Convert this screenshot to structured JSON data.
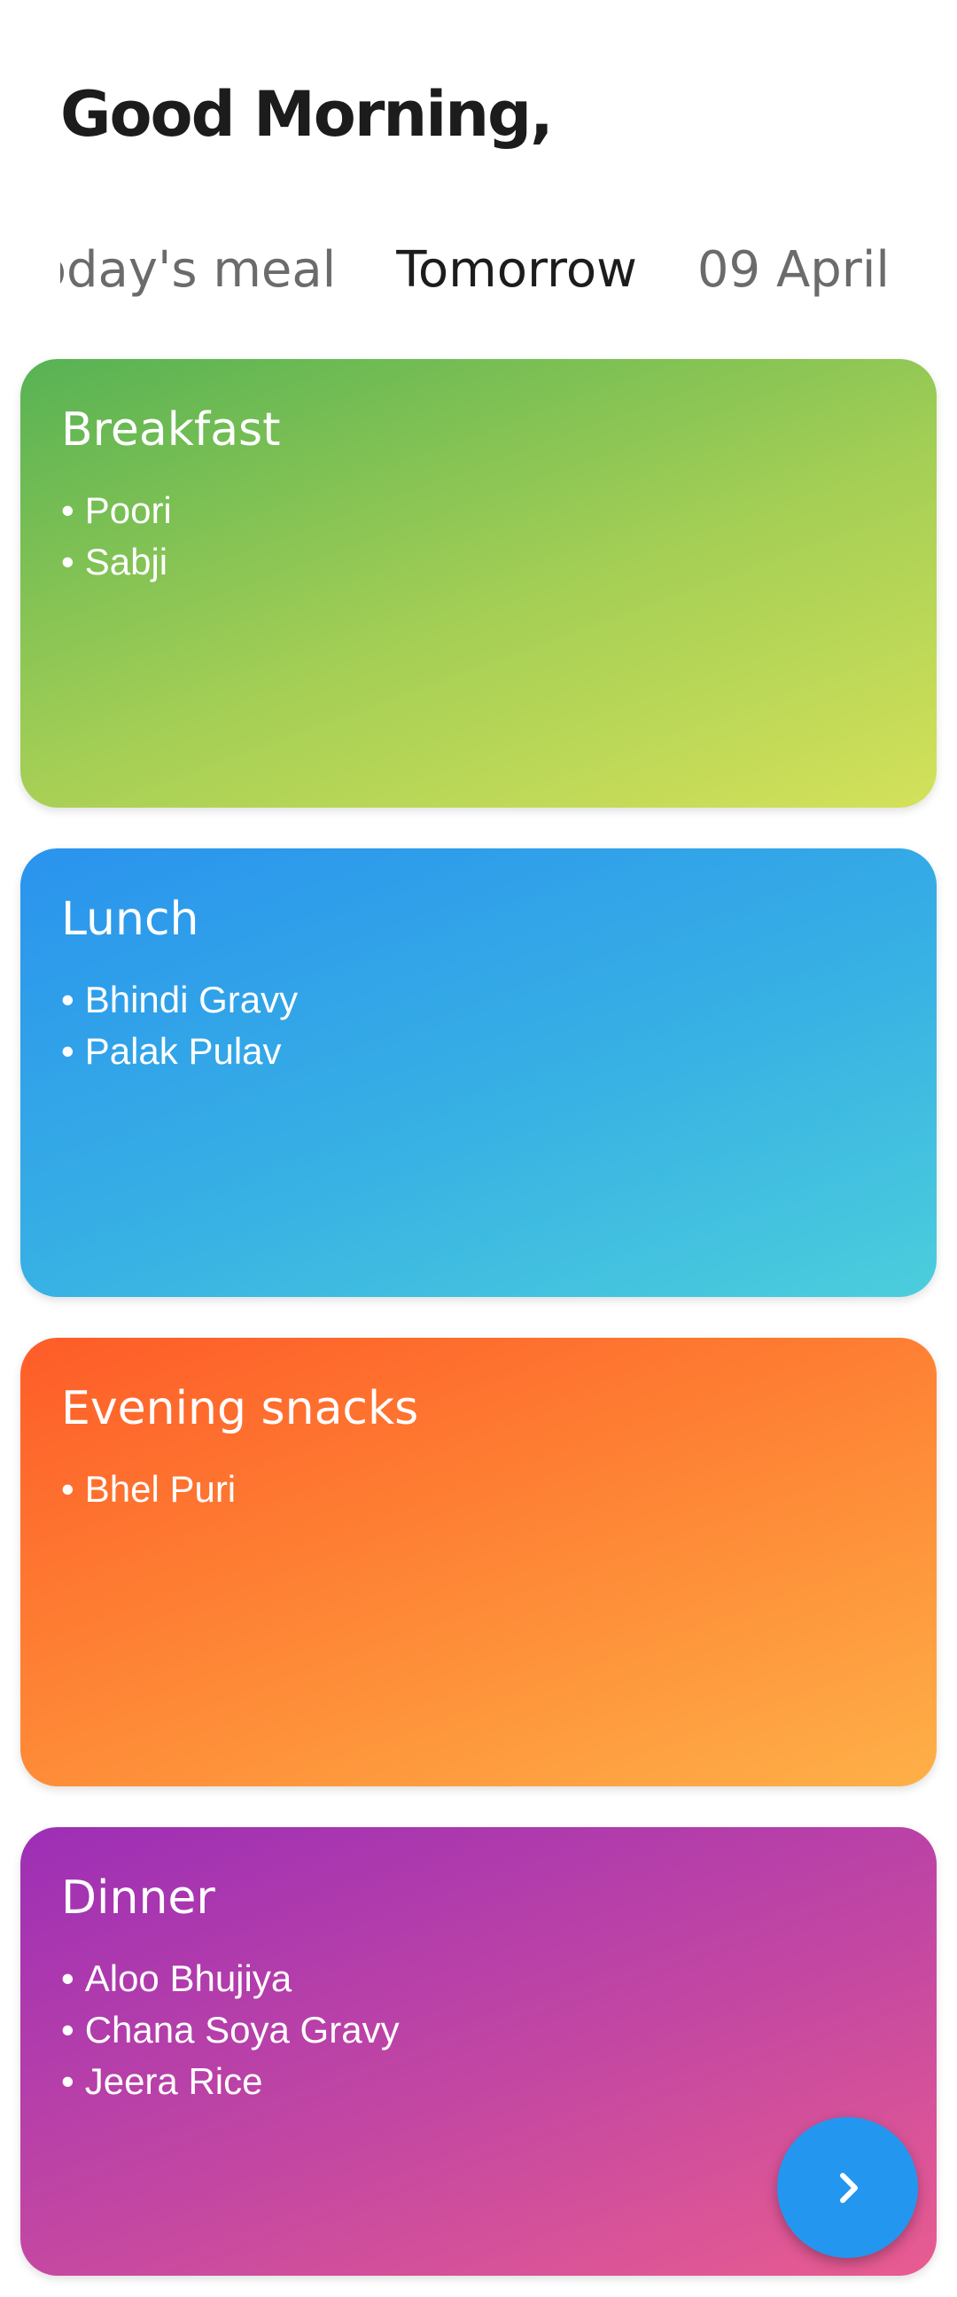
{
  "header": {
    "greeting": "Good Morning,"
  },
  "tabs": [
    {
      "label": "Today's meal",
      "active": false
    },
    {
      "label": "Tomorrow",
      "active": true
    },
    {
      "label": "09 April",
      "active": false
    }
  ],
  "meals": [
    {
      "title": "Breakfast",
      "items": [
        "Poori",
        "Sabji"
      ],
      "colors": [
        "#57b254",
        "#d4e15a"
      ]
    },
    {
      "title": "Lunch",
      "items": [
        "Bhindi Gravy",
        "Palak Pulav"
      ],
      "colors": [
        "#2a93ee",
        "#4ccedc"
      ]
    },
    {
      "title": "Evening snacks",
      "items": [
        "Bhel Puri"
      ],
      "colors": [
        "#fe5c28",
        "#feb048"
      ]
    },
    {
      "title": "Dinner",
      "items": [
        "Aloo Bhujiya",
        "Chana Soya Gravy",
        "Jeera Rice"
      ],
      "colors": [
        "#9d2fb6",
        "#e85c90"
      ]
    }
  ],
  "bullet": "•",
  "fab": {
    "icon": "chevron-right-icon",
    "color": "#2397f0"
  }
}
